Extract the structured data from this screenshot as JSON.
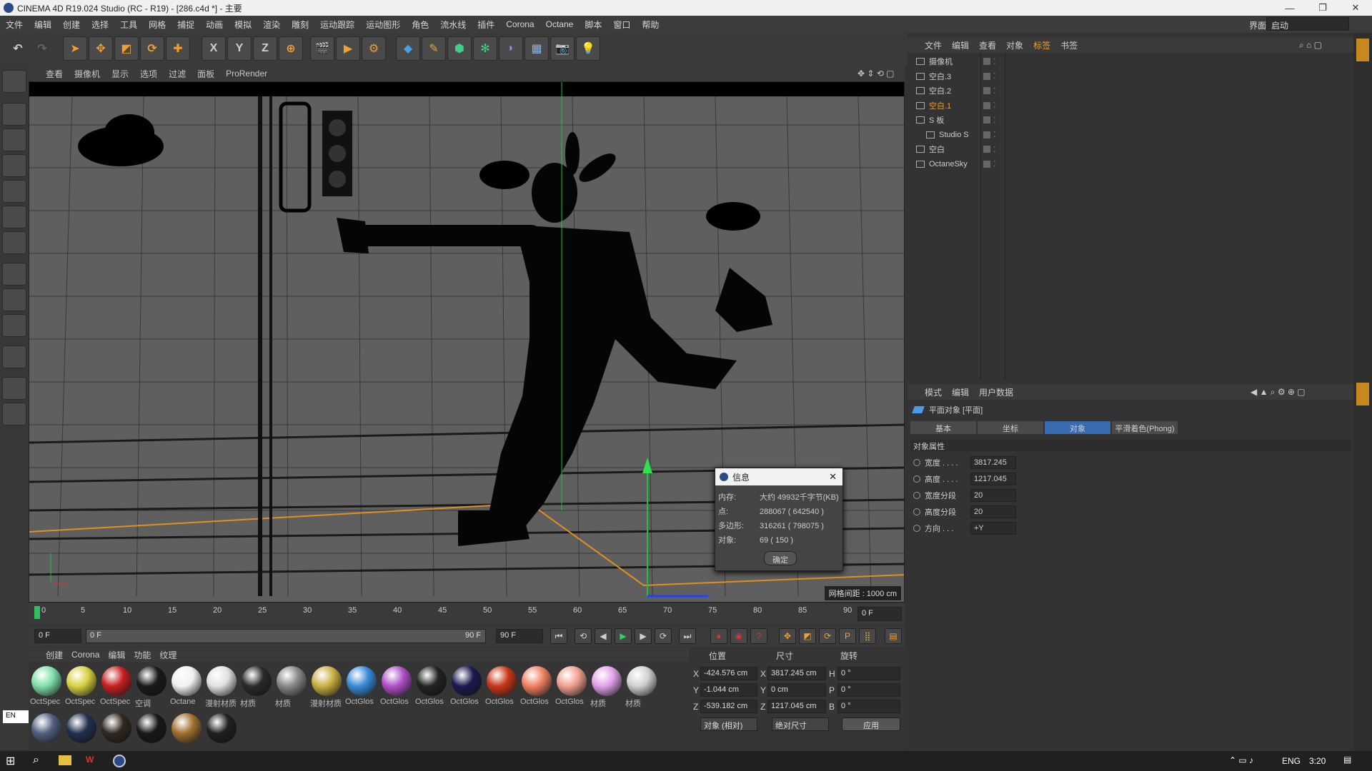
{
  "window": {
    "title": "CINEMA 4D R19.024 Studio (RC - R19) - [286.c4d *] - 主要"
  },
  "menu": [
    "文件",
    "编辑",
    "创建",
    "选择",
    "工具",
    "网格",
    "捕捉",
    "动画",
    "模拟",
    "渲染",
    "雕刻",
    "运动跟踪",
    "运动图形",
    "角色",
    "流水线",
    "插件",
    "Corona",
    "Octane",
    "脚本",
    "窗口",
    "帮助"
  ],
  "layout": {
    "label": "界面:",
    "value": "启动"
  },
  "toolbar": {
    "x": "X",
    "y": "Y",
    "z": "Z"
  },
  "viewport": {
    "menus": [
      "查看",
      "摄像机",
      "显示",
      "选项",
      "过滤",
      "面板",
      "ProRender"
    ],
    "grid_spacing": "网格间距 : 1000 cm"
  },
  "timeline": {
    "ticks": [
      "0",
      "5",
      "10",
      "15",
      "20",
      "25",
      "30",
      "35",
      "40",
      "45",
      "50",
      "55",
      "60",
      "65",
      "70",
      "75",
      "80",
      "85",
      "90"
    ],
    "current_frame": "0 F"
  },
  "playback": {
    "start": "0 F",
    "range_start": "0 F",
    "range_end": "90 F",
    "end": "90 F"
  },
  "materials": {
    "tabs": [
      "创建",
      "Corona",
      "编辑",
      "功能",
      "纹理"
    ],
    "items": [
      {
        "label": "OctSpec",
        "color": "#7fe0a8"
      },
      {
        "label": "OctSpec",
        "color": "#d8d040"
      },
      {
        "label": "OctSpec",
        "color": "#c82020"
      },
      {
        "label": "空调",
        "color": "#1a1a1a"
      },
      {
        "label": "Octane",
        "color": "#f0f0f0"
      },
      {
        "label": "漫射材质",
        "color": "#e0e0e0"
      },
      {
        "label": "材质",
        "color": "#2a2a2a"
      },
      {
        "label": "材质",
        "color": "#888888"
      },
      {
        "label": "漫射材质",
        "color": "#c8b040"
      },
      {
        "label": "OctGlos",
        "color": "#3a8ad8"
      },
      {
        "label": "OctGlos",
        "color": "#b050c8"
      },
      {
        "label": "OctGlos",
        "color": "#222222"
      },
      {
        "label": "OctGlos",
        "color": "#1a1a50"
      },
      {
        "label": "OctGlos",
        "color": "#c83818"
      },
      {
        "label": "OctGlos",
        "color": "#f08060"
      },
      {
        "label": "OctGlos",
        "color": "#f0a090"
      },
      {
        "label": "材质",
        "color": "#e0a0e8"
      },
      {
        "label": "材质",
        "color": "#d0d0d0"
      }
    ],
    "row2": [
      "#506080",
      "#203050",
      "#302820",
      "#181818",
      "#a07030",
      "#202020"
    ]
  },
  "ime": "EN",
  "coords": {
    "headers": [
      "位置",
      "尺寸",
      "旋转"
    ],
    "rows": [
      {
        "axis": "X",
        "pos": "-424.576 cm",
        "size_axis": "X",
        "size": "3817.245 cm",
        "rot_axis": "H",
        "rot": "0 °"
      },
      {
        "axis": "Y",
        "pos": "-1.044 cm",
        "size_axis": "Y",
        "size": "0 cm",
        "rot_axis": "P",
        "rot": "0 °"
      },
      {
        "axis": "Z",
        "pos": "-539.182 cm",
        "size_axis": "Z",
        "size": "1217.045 cm",
        "rot_axis": "B",
        "rot": "0 °"
      }
    ],
    "mode": "对象 (相对)",
    "size_mode": "绝对尺寸",
    "apply": "应用"
  },
  "objects": {
    "menus": [
      "文件",
      "编辑",
      "查看",
      "对象",
      "标签",
      "书签"
    ],
    "items": [
      {
        "name": "摄像机",
        "color": "#cccccc"
      },
      {
        "name": "空白.3",
        "color": "#cccccc"
      },
      {
        "name": "空白.2",
        "color": "#cccccc"
      },
      {
        "name": "空白.1",
        "color": "#e8a030"
      },
      {
        "name": "S 板",
        "color": "#cccccc"
      },
      {
        "name": "Studio S",
        "color": "#cccccc"
      },
      {
        "name": "空白",
        "color": "#cccccc"
      },
      {
        "name": "OctaneSky",
        "color": "#cccccc"
      }
    ]
  },
  "attributes": {
    "menus": [
      "模式",
      "编辑",
      "用户数据"
    ],
    "object_title": "平面对象 [平面]",
    "tabs": [
      "基本",
      "坐标",
      "对象",
      "平滑着色(Phong)"
    ],
    "section": "对象属性",
    "fields": [
      {
        "label": "宽度 . . . .",
        "value": "3817.245"
      },
      {
        "label": "高度 . . . .",
        "value": "1217.045"
      },
      {
        "label": "宽度分段",
        "value": "20"
      },
      {
        "label": "高度分段",
        "value": "20"
      },
      {
        "label": "方向 . . .",
        "value": "+Y"
      }
    ]
  },
  "info_dialog": {
    "title": "信息",
    "rows": [
      {
        "k": "内存:",
        "v": "大约 49932千字节(KB)"
      },
      {
        "k": "点:",
        "v": "288067 ( 642540 )"
      },
      {
        "k": "多边形:",
        "v": "316261 ( 798075 )"
      },
      {
        "k": "对象:",
        "v": "69 ( 150 )"
      }
    ],
    "ok": "确定"
  },
  "taskbar": {
    "lang": "ENG",
    "time": "3:20"
  }
}
